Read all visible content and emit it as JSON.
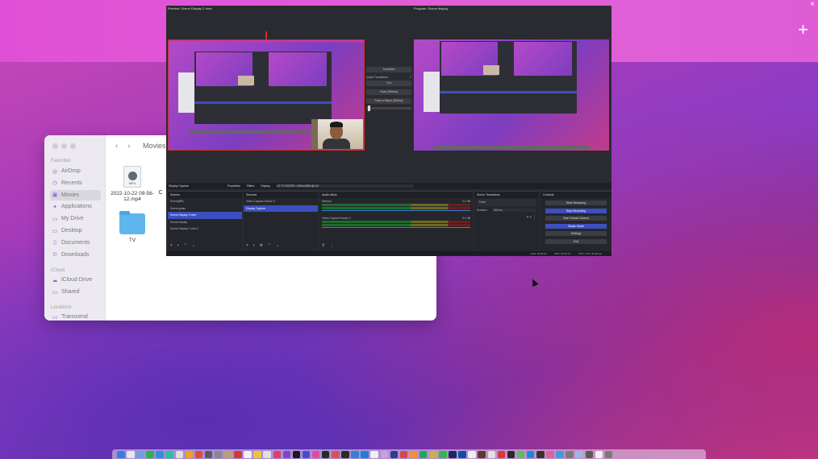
{
  "desktop": {
    "top_right_plus": "+",
    "top_right_close": "×"
  },
  "finder": {
    "title": "Movies",
    "nav_back": "‹",
    "nav_forward": "›",
    "sections": {
      "favorites": "Favorites",
      "icloud": "iCloud",
      "locations": "Locations"
    },
    "favorites": [
      {
        "label": "AirDrop",
        "icon": "airdrop-icon",
        "glyph": "◎"
      },
      {
        "label": "Recents",
        "icon": "clock-icon",
        "glyph": "◷"
      },
      {
        "label": "Movies",
        "icon": "film-icon",
        "glyph": "▣"
      },
      {
        "label": "Applications",
        "icon": "applications-icon",
        "glyph": "✦"
      },
      {
        "label": "My Drive",
        "icon": "drive-icon",
        "glyph": "▭"
      },
      {
        "label": "Desktop",
        "icon": "desktop-icon",
        "glyph": "▭"
      },
      {
        "label": "Documents",
        "icon": "document-icon",
        "glyph": "▯"
      },
      {
        "label": "Downloads",
        "icon": "download-icon",
        "glyph": "⊙"
      }
    ],
    "icloud": [
      {
        "label": "iCloud Drive",
        "icon": "cloud-icon",
        "glyph": "☁"
      },
      {
        "label": "Shared",
        "icon": "shared-folder-icon",
        "glyph": "▭"
      }
    ],
    "locations": [
      {
        "label": "Transcend",
        "icon": "disk-icon",
        "glyph": "▭"
      }
    ],
    "files": [
      {
        "name": "2022-10-22 09-56-12.mp4",
        "kind": "MP4"
      },
      {
        "name": "TV",
        "kind": "folder"
      }
    ],
    "partial_file_label": "C"
  },
  "obs": {
    "preview_label": "Preview: Scene Display 2 view",
    "program_label": "Program: Scene display",
    "transitions": {
      "transition_label": "Transition",
      "quick_transitions_label": "Quick Transitions",
      "cut_label": "Cut",
      "fade_label": "Fade (300ms)",
      "fade_black_label": "Fade to Black (300ms)"
    },
    "context_bar": {
      "source_name": "Display Capture",
      "properties": "Properties",
      "filters": "Filters",
      "display_label": "Display",
      "display_value": "LG TV SSCR2: 1920x1080 @ 0,0"
    },
    "scenes": {
      "header": "Scenes",
      "items": [
        "Scene(BR)",
        "Scene grass",
        "Scene Display 2 view",
        "Scene display",
        "Scene Display 2 view 2"
      ],
      "selected": 2
    },
    "sources": {
      "header": "Sources",
      "items": [
        "Video Capture Device 2",
        "Display Capture"
      ],
      "selected": 1
    },
    "audio_mixer": {
      "header": "Audio Mixer",
      "channels": [
        {
          "name": "Mic/Aux",
          "db": "0.0 dB"
        },
        {
          "name": "Video Capture Device 2",
          "db": "0.0 dB"
        }
      ]
    },
    "scene_transitions": {
      "header": "Scene Transitions",
      "type": "Fade",
      "duration_label": "Duration",
      "duration_value": "300 ms"
    },
    "controls": {
      "header": "Controls",
      "buttons": [
        "Start Streaming",
        "Stop Recording",
        "Start Virtual Camera",
        "Studio Mode",
        "Settings",
        "Exit"
      ]
    },
    "status_bar": {
      "live": "LIVE: 00:00:00",
      "rec": "REC: 00:00:01",
      "cpu": "CPU: 0.0%, 60.00 fps"
    }
  },
  "dock": {
    "icons": [
      "#3b7ddd",
      "#e7e7e7",
      "#6aa0e0",
      "#2fb24c",
      "#2f8fe0",
      "#27c2a0",
      "#e0e0e0",
      "#f4a020",
      "#e24b3b",
      "#5a5a5a",
      "#888",
      "#bba070",
      "#d23a3a",
      "#f0f0f0",
      "#f2c230",
      "#e0e0e0",
      "#e23c6a",
      "#7a49c9",
      "#1a1a1a",
      "#4b4bd1",
      "#e04ba0",
      "#2a2a2a",
      "#e05050",
      "#2b2b2b",
      "#3a7fd0",
      "#1e7fd6",
      "#f0f0f0",
      "#c8a0e0",
      "#2d3f8f",
      "#d84848",
      "#f09030",
      "#1fa85a",
      "#c8b050",
      "#36b54a",
      "#1e2a5a",
      "#0d4fa8",
      "#eeeeee",
      "#5a3a2a",
      "#e0e0e0",
      "#d83a3a",
      "#2a2a2a",
      "#5abf5a",
      "#1b88e0",
      "#333",
      "#e05fa0",
      "#3a9ee0",
      "#7a7a7a",
      "#9bb6e0",
      "#5a5a5a",
      "#f0f0f0",
      "#7a7a7a"
    ]
  }
}
